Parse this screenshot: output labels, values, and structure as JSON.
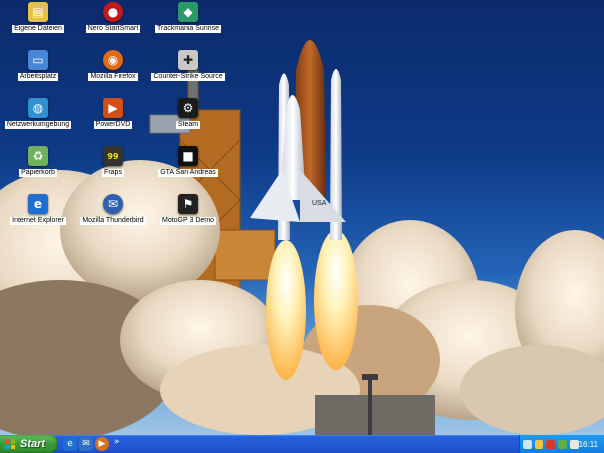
{
  "desktop": {
    "icons": [
      {
        "label": "Eigene Dateien",
        "icon": "folder-icon",
        "color": "#e7c04a"
      },
      {
        "label": "Arbeitsplatz",
        "icon": "computer-icon",
        "color": "#4a86d8"
      },
      {
        "label": "Netzwerkumgebung",
        "icon": "network-icon",
        "color": "#2f8fd0"
      },
      {
        "label": "Papierkorb",
        "icon": "recycle-bin-icon",
        "color": "#6fb15c"
      },
      {
        "label": "Internet Explorer",
        "icon": "internet-explorer-icon",
        "color": "#1f6fd1"
      },
      {
        "label": "Nero StartSmart",
        "icon": "nero-icon",
        "color": "#c21a1a"
      },
      {
        "label": "Mozilla Firefox",
        "icon": "firefox-icon",
        "color": "#e06a16"
      },
      {
        "label": "PowerDVD",
        "icon": "powerdvd-icon",
        "color": "#d14f16"
      },
      {
        "label": "Fraps",
        "icon": "fraps-icon",
        "color": "#333333"
      },
      {
        "label": "Mozilla Thunderbird",
        "icon": "thunderbird-icon",
        "color": "#2f5fb0"
      },
      {
        "label": "Trackmania Sunrise",
        "icon": "trackmania-icon",
        "color": "#2b9a6a"
      },
      {
        "label": "Counter-Strike Source",
        "icon": "counter-strike-icon",
        "color": "#c8c8c8"
      },
      {
        "label": "Steam",
        "icon": "steam-icon",
        "color": "#1b1b1b"
      },
      {
        "label": "GTA San Andreas",
        "icon": "gta-icon",
        "color": "#111111"
      },
      {
        "label": "MotoGP 3 Demo",
        "icon": "motogp-icon",
        "color": "#222222"
      }
    ]
  },
  "taskbar": {
    "start_label": "Start",
    "quick_launch": [
      "internet-explorer-icon",
      "outlook-icon",
      "media-player-icon"
    ],
    "clock": "16:11",
    "tray_icons": [
      "speaker-icon",
      "network-icon",
      "security-icon",
      "update-icon",
      "shield-icon"
    ],
    "colors": {
      "taskbar": "#245edb",
      "start": "#3b9a37",
      "tray": "#127de2"
    }
  }
}
